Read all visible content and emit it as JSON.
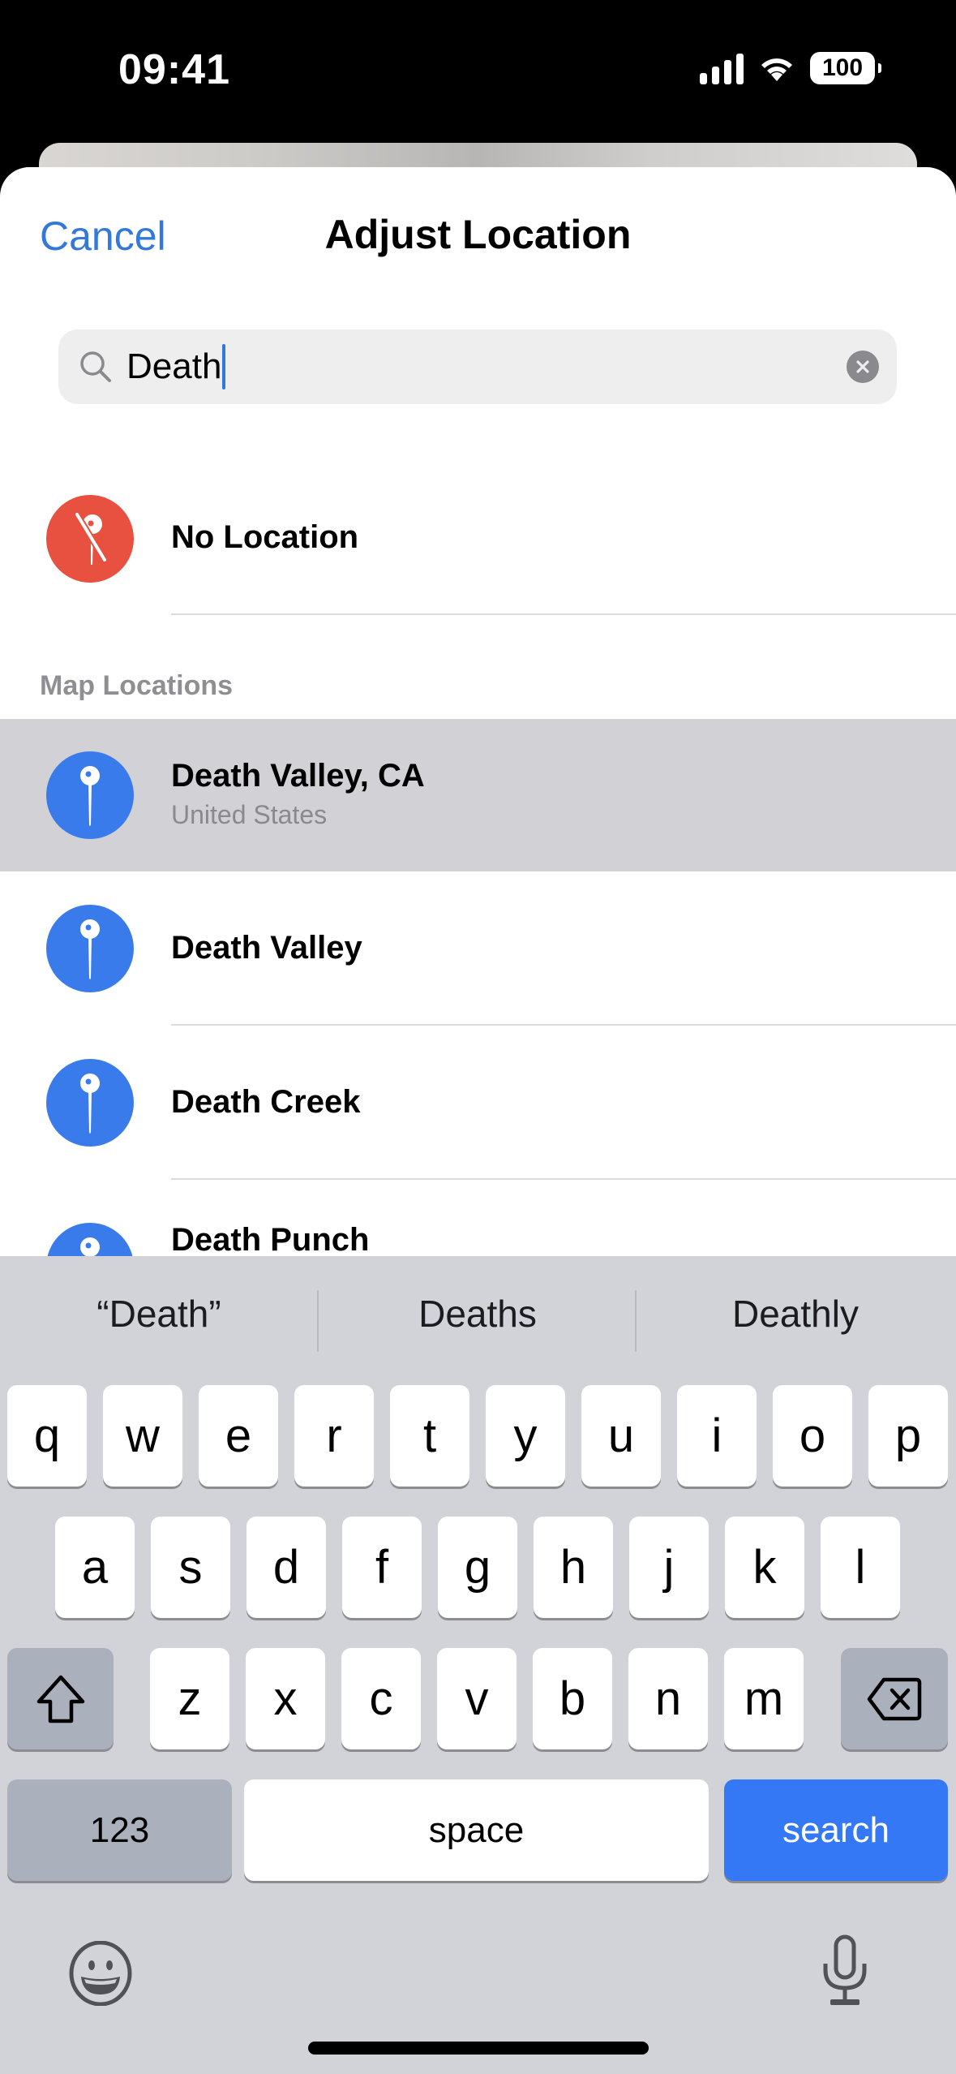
{
  "status_bar": {
    "time": "09:41",
    "battery": "100",
    "icons": [
      "signal-icon",
      "wifi-icon",
      "battery-icon"
    ]
  },
  "nav": {
    "cancel_label": "Cancel",
    "title": "Adjust Location"
  },
  "search": {
    "value": "Death",
    "icon": "search-icon",
    "clear_icon": "clear-icon"
  },
  "no_location": {
    "label": "No Location",
    "icon": "location-slash-icon",
    "color": "#e8503f"
  },
  "section_header": "Map Locations",
  "results": [
    {
      "title": "Death Valley, CA",
      "subtitle": "United States",
      "highlighted": true
    },
    {
      "title": "Death Valley",
      "subtitle": null,
      "highlighted": false
    },
    {
      "title": "Death Creek",
      "subtitle": null,
      "highlighted": false
    },
    {
      "title": "Death Punch",
      "subtitle": null,
      "highlighted": false
    }
  ],
  "colors": {
    "accent": "#3478d9",
    "pin_blue": "#3a7bec",
    "highlight_bg": "#d1d1d6",
    "keyboard_bg": "#d1d3d9",
    "search_key": "#3478f6"
  },
  "keyboard": {
    "suggestions": [
      "“Death”",
      "Deaths",
      "Deathly"
    ],
    "row1": [
      "q",
      "w",
      "e",
      "r",
      "t",
      "y",
      "u",
      "i",
      "o",
      "p"
    ],
    "row2": [
      "a",
      "s",
      "d",
      "f",
      "g",
      "h",
      "j",
      "k",
      "l"
    ],
    "row3": [
      "z",
      "x",
      "c",
      "v",
      "b",
      "n",
      "m"
    ],
    "numbers_label": "123",
    "space_label": "space",
    "search_label": "search",
    "shift_icon": "shift-icon",
    "delete_icon": "delete-icon",
    "emoji_icon": "emoji-icon",
    "mic_icon": "microphone-icon"
  }
}
